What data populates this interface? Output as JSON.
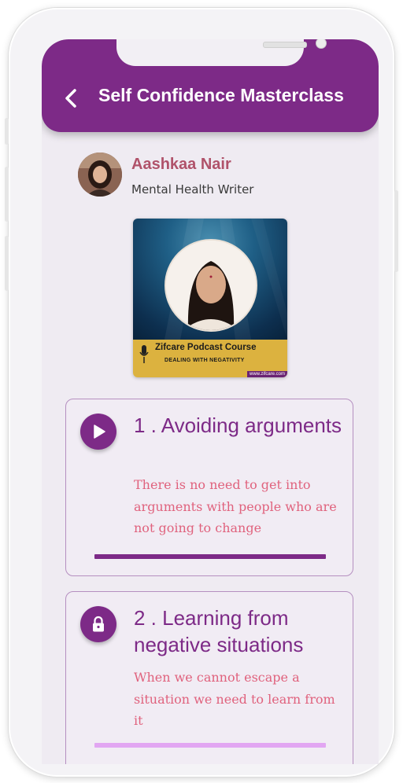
{
  "header": {
    "title": "Self Confidence Masterclass"
  },
  "author": {
    "name": "Aashkaa Nair",
    "role": "Mental Health Writer"
  },
  "cover": {
    "title": "Zifcare Podcast Course",
    "subtitle": "DEALING WITH NEGATIVITY",
    "url": "www.zifcare.com"
  },
  "lessons": [
    {
      "title": "1 . Avoiding arguments",
      "description": "There is no need to get into arguments with people who are not going to change",
      "icon": "play-icon",
      "status": "playable",
      "progress": 1.0,
      "progress_color": "#7d2a87"
    },
    {
      "title": "2 . Learning from negative situations",
      "description": "When we cannot escape a situation we need to learn from it",
      "icon": "lock-icon",
      "status": "locked",
      "progress": 1.0,
      "progress_color": "#e2a6f2"
    }
  ],
  "colors": {
    "brand": "#7d2a87",
    "accent": "#e0627d",
    "author": "#b0526a",
    "cover_band": "#dcb23f"
  }
}
